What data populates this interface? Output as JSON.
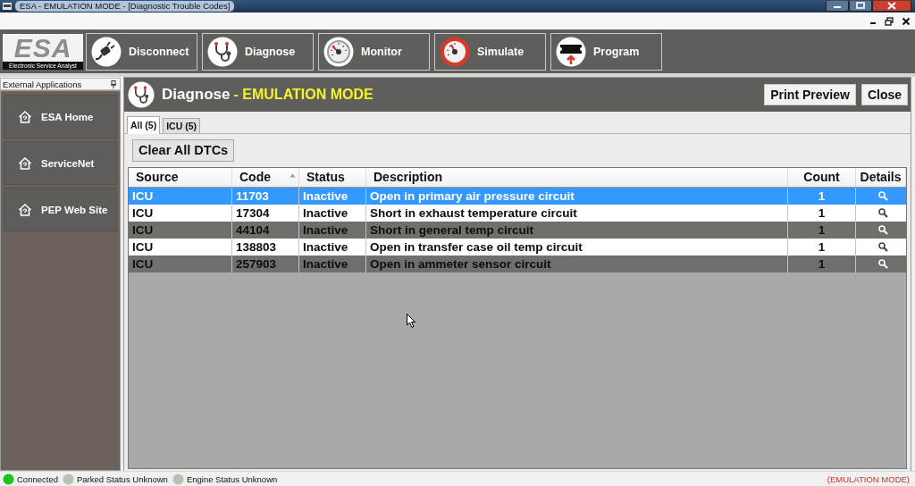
{
  "window": {
    "title": "ESA - EMULATION MODE - [Diagnostic Trouble Codes]"
  },
  "logo": {
    "name": "ESA",
    "tagline": "Electronic Service Analyst"
  },
  "toolbar": [
    {
      "label": "Disconnect",
      "kind": "connection"
    },
    {
      "label": "Diagnose",
      "kind": "diagnose"
    },
    {
      "label": "Monitor",
      "kind": "monitor"
    },
    {
      "label": "Simulate",
      "kind": "simulate"
    },
    {
      "label": "Program",
      "kind": "program"
    }
  ],
  "sidebar": {
    "title": "External Applications",
    "items": [
      {
        "label": "ESA Home"
      },
      {
        "label": "ServiceNet"
      },
      {
        "label": "PEP Web Site"
      }
    ]
  },
  "panel": {
    "title": "Diagnose",
    "mode": "- EMULATION MODE",
    "buttons": [
      "Print Preview",
      "Close"
    ]
  },
  "tabs": [
    {
      "label": "All (5)",
      "selected": true
    },
    {
      "label": "ICU (5)",
      "selected": false
    }
  ],
  "clear_button": "Clear All DTCs",
  "table": {
    "columns": [
      {
        "label": "Source",
        "sorted": false
      },
      {
        "label": "Code",
        "sorted": true
      },
      {
        "label": "Status",
        "sorted": false
      },
      {
        "label": "Description",
        "sorted": false
      },
      {
        "label": "Count",
        "sorted": false
      },
      {
        "label": "Details",
        "sorted": false
      }
    ],
    "rows": [
      {
        "source": "ICU",
        "code": "11703",
        "status": "Inactive",
        "description": "Open in primary air pressure circuit",
        "count": "1",
        "selected": true
      },
      {
        "source": "ICU",
        "code": "17304",
        "status": "Inactive",
        "description": "Short in exhaust temperature circuit",
        "count": "1",
        "selected": false
      },
      {
        "source": "ICU",
        "code": "44104",
        "status": "Inactive",
        "description": "Short in general temp circuit",
        "count": "1",
        "selected": false
      },
      {
        "source": "ICU",
        "code": "138803",
        "status": "Inactive",
        "description": "Open in transfer case oil temp circuit",
        "count": "1",
        "selected": false
      },
      {
        "source": "ICU",
        "code": "257903",
        "status": "Inactive",
        "description": "Open in ammeter sensor circuit",
        "count": "1",
        "selected": false
      }
    ]
  },
  "status_bar": {
    "indicators": [
      {
        "label": "Connected",
        "color": "#1fc21f"
      },
      {
        "label": "Parked Status Unknown",
        "color": "#b9c2b0"
      },
      {
        "label": "Engine Status Unknown",
        "color": "#b9c2b0"
      }
    ],
    "mode": "(EMULATION MODE)"
  }
}
